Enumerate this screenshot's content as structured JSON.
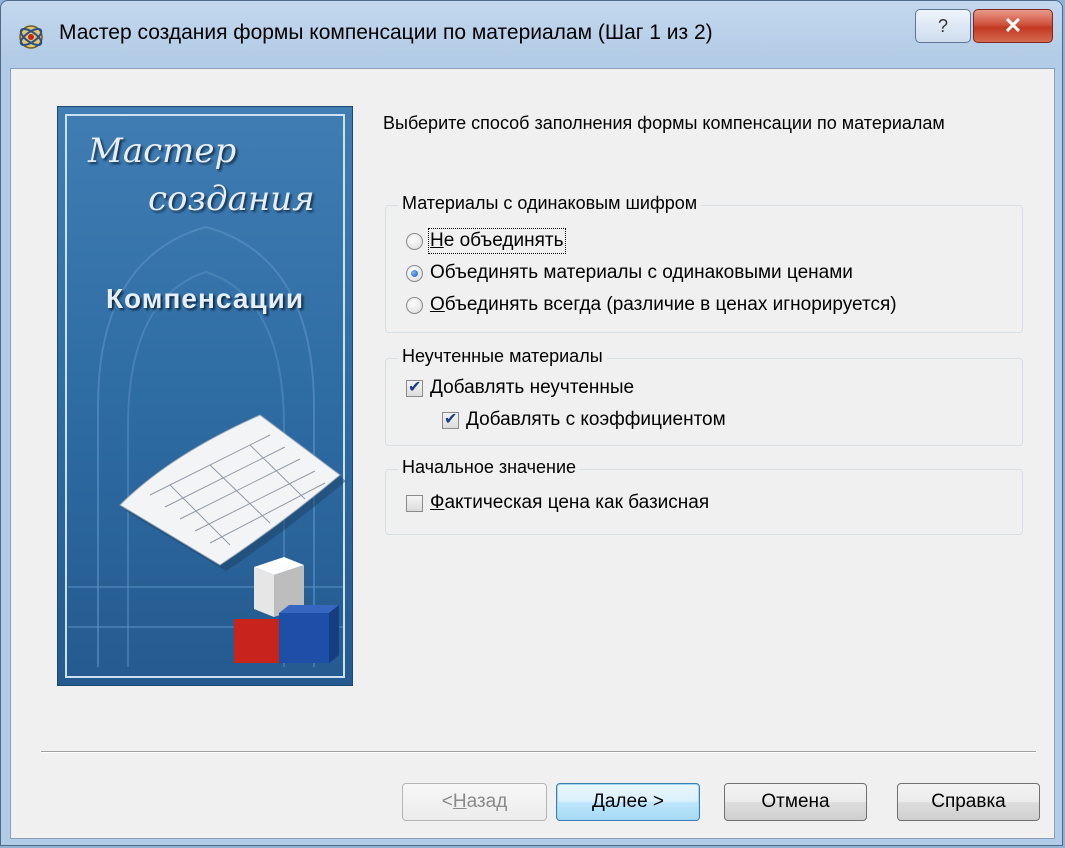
{
  "window": {
    "title": "Мастер создания формы компенсации по материалам (Шаг 1 из 2)",
    "help_glyph": "?",
    "close_glyph": "✕"
  },
  "banner": {
    "line1": "Мастер",
    "line2": "создания",
    "line3": "Компенсации"
  },
  "prompt": "Выберите способ заполнения формы компенсации по материалам",
  "group_same_code": {
    "label": "Материалы с одинаковым шифром",
    "options": [
      {
        "label": "Не объединять",
        "mnemonic": "Н",
        "rest": "е объединять",
        "selected": false
      },
      {
        "label": "Объединять материалы с одинаковыми ценами",
        "selected": true
      },
      {
        "label": "Объединять всегда (различие в ценах игнорируется)",
        "mnemonic": "О",
        "rest": "бъединять всегда (различие в ценах игнорируется)",
        "selected": false
      }
    ]
  },
  "group_unaccounted": {
    "label": "Неучтенные материалы",
    "add_unaccounted": {
      "label": "Добавлять неучтенные",
      "checked": true
    },
    "add_with_coef": {
      "label": "Добавлять с коэффициентом",
      "checked": true
    }
  },
  "group_initial": {
    "label": "Начальное значение",
    "actual_price": {
      "label": "Фактическая цена как базисная",
      "mnemonic": "Ф",
      "rest": "актическая цена как базисная",
      "checked": false
    }
  },
  "buttons": {
    "back": "< Назад",
    "back_prefix": "< ",
    "back_mnemonic": "Н",
    "back_rest": "азад",
    "next": "Далее >",
    "cancel": "Отмена",
    "help": "Справка"
  },
  "colors": {
    "banner_blue": "#2e6ca4",
    "cube_red": "#c8241c",
    "cube_blue": "#1e4fa8",
    "close_red": "#c23820"
  }
}
